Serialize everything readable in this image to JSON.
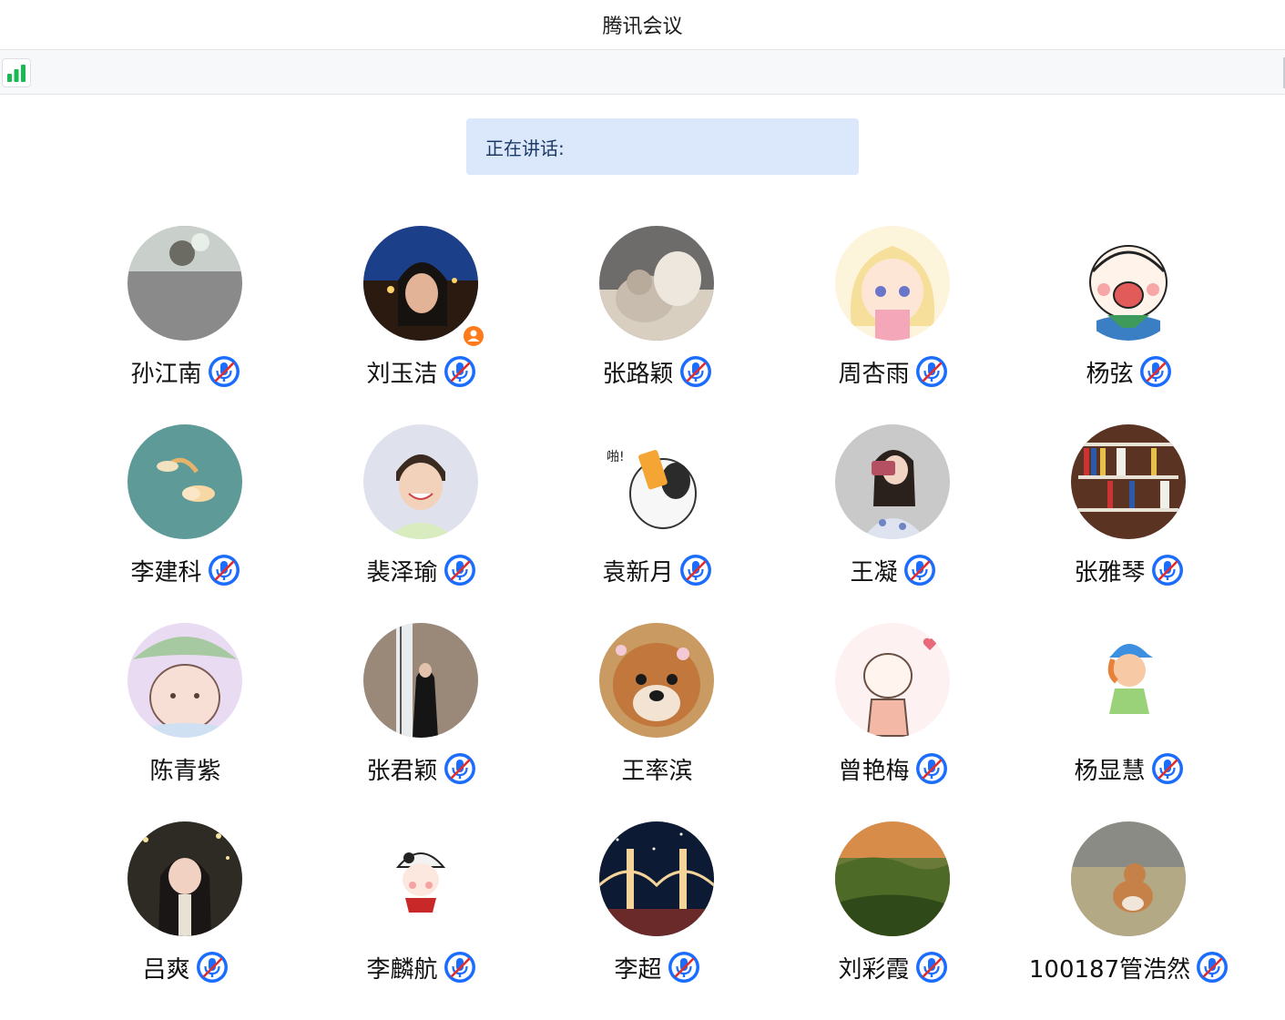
{
  "window": {
    "title": "腾讯会议"
  },
  "toolbar": {
    "signal_icon": "signal-bars-icon",
    "signal_color": "#2ecc71"
  },
  "speaking_panel": {
    "label": "正在讲话:"
  },
  "colors": {
    "mic_badge": "#1a6dff",
    "mic_slash": "#e02d2d",
    "host_badge": "#ff7a1a"
  },
  "participants": [
    {
      "name": "孙江南",
      "muted": true,
      "avatar": "mist-photo"
    },
    {
      "name": "刘玉洁",
      "muted": true,
      "avatar": "night-portrait-photo",
      "host": true
    },
    {
      "name": "张路颖",
      "muted": true,
      "avatar": "cat-dog-photo"
    },
    {
      "name": "周杏雨",
      "muted": true,
      "avatar": "anime-girl-drawing"
    },
    {
      "name": "杨弦",
      "muted": true,
      "avatar": "cartoon-boy-drawing"
    },
    {
      "name": "李建科",
      "muted": true,
      "avatar": "rainbow-cloud-photo"
    },
    {
      "name": "裴泽瑜",
      "muted": true,
      "avatar": "smiling-child-photo"
    },
    {
      "name": "袁新月",
      "muted": true,
      "avatar": "cartoon-cat-drawing"
    },
    {
      "name": "王凝",
      "muted": true,
      "avatar": "mirror-selfie-photo"
    },
    {
      "name": "张雅琴",
      "muted": true,
      "avatar": "bookshelf-photo"
    },
    {
      "name": "陈青紫",
      "muted": false,
      "avatar": "bunny-leaf-drawing"
    },
    {
      "name": "张君颖",
      "muted": true,
      "avatar": "woman-window-photo"
    },
    {
      "name": "王率滨",
      "muted": false,
      "avatar": "shiba-dog-photo"
    },
    {
      "name": "曾艳梅",
      "muted": true,
      "avatar": "cartoon-girl-heart-drawing"
    },
    {
      "name": "杨显慧",
      "muted": true,
      "avatar": "cartoon-boy-hat-drawing"
    },
    {
      "name": "吕爽",
      "muted": true,
      "avatar": "woman-lights-photo"
    },
    {
      "name": "李麟航",
      "muted": true,
      "avatar": "cow-hat-girl-drawing"
    },
    {
      "name": "李超",
      "muted": true,
      "avatar": "bridge-night-photo"
    },
    {
      "name": "刘彩霞",
      "muted": true,
      "avatar": "green-valley-photo"
    },
    {
      "name": "100187管浩然",
      "muted": true,
      "avatar": "corgi-lawn-photo"
    }
  ]
}
